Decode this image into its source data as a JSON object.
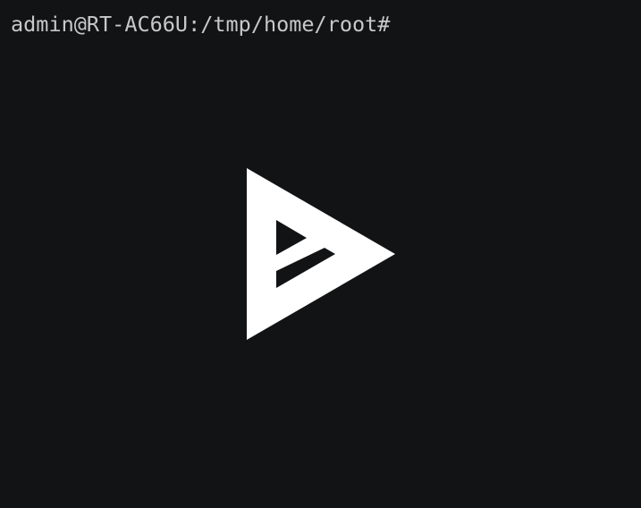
{
  "terminal": {
    "prompt": "admin@RT-AC66U:/tmp/home/root#",
    "background": "#121315",
    "text_color": "#c8c8c8"
  },
  "logo": {
    "icon": "asciinema-logo-icon",
    "color": "#ffffff"
  }
}
